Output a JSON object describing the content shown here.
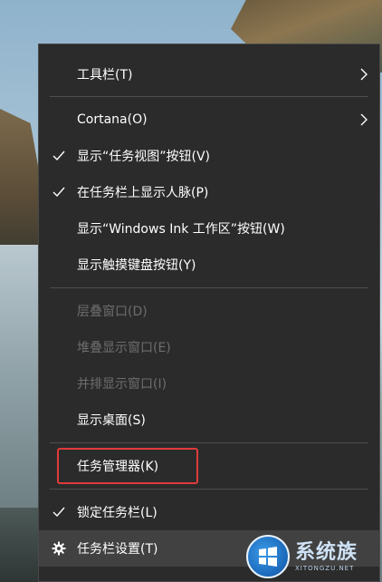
{
  "context_menu": {
    "items": [
      {
        "label": "工具栏(T)",
        "checked": false,
        "submenu": true,
        "disabled": false
      },
      {
        "label": "Cortana(O)",
        "checked": false,
        "submenu": true,
        "disabled": false
      },
      {
        "label": "显示“任务视图”按钮(V)",
        "checked": true,
        "submenu": false,
        "disabled": false
      },
      {
        "label": "在任务栏上显示人脉(P)",
        "checked": true,
        "submenu": false,
        "disabled": false
      },
      {
        "label": "显示“Windows Ink 工作区”按钮(W)",
        "checked": false,
        "submenu": false,
        "disabled": false
      },
      {
        "label": "显示触摸键盘按钮(Y)",
        "checked": false,
        "submenu": false,
        "disabled": false
      },
      {
        "label": "层叠窗口(D)",
        "checked": false,
        "submenu": false,
        "disabled": true
      },
      {
        "label": "堆叠显示窗口(E)",
        "checked": false,
        "submenu": false,
        "disabled": true
      },
      {
        "label": "并排显示窗口(I)",
        "checked": false,
        "submenu": false,
        "disabled": true
      },
      {
        "label": "显示桌面(S)",
        "checked": false,
        "submenu": false,
        "disabled": false
      },
      {
        "label": "任务管理器(K)",
        "checked": false,
        "submenu": false,
        "disabled": false,
        "annotated": true
      },
      {
        "label": "锁定任务栏(L)",
        "checked": true,
        "submenu": false,
        "disabled": false
      },
      {
        "label": "任务栏设置(T)",
        "checked": false,
        "submenu": false,
        "disabled": false,
        "icon": "gear-icon",
        "hovered": true
      }
    ]
  },
  "colors": {
    "menu_bg": "#2b2b2b",
    "hover_bg": "#414141",
    "disabled_text": "#6d6d6d",
    "highlight_border": "#e03b3b"
  },
  "watermark": {
    "main": "系统族",
    "sub": "XITONGZU.NET"
  }
}
